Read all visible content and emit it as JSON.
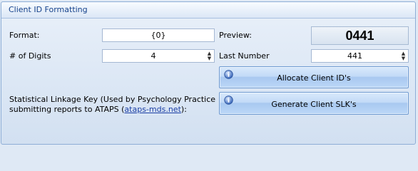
{
  "group": {
    "title": "Client ID Formatting"
  },
  "format": {
    "label": "Format:",
    "value": "{0}"
  },
  "preview": {
    "label": "Preview:",
    "value": "0441"
  },
  "digits": {
    "label": "# of Digits",
    "value": "4"
  },
  "last_number": {
    "label": "Last Number",
    "value": "441"
  },
  "buttons": {
    "allocate": "Allocate Client ID's",
    "generate": "Generate Client SLK's",
    "icon": "info-shield-icon"
  },
  "slk": {
    "line1": "Statistical Linkage Key (Used by Psychology Practice",
    "line2_prefix": "submitting reports to ATAPS (",
    "link": "ataps-mds.net",
    "line2_suffix": "):"
  }
}
